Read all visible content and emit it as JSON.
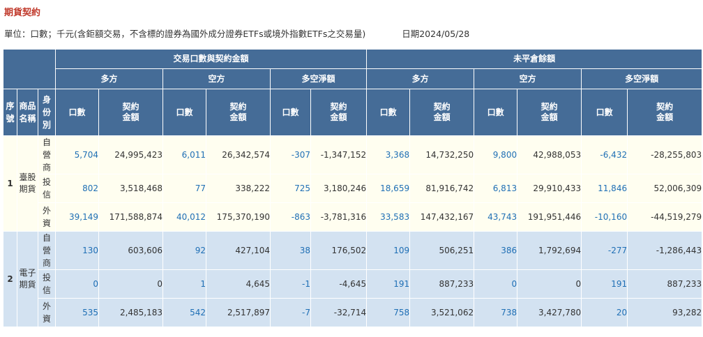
{
  "page": {
    "title": "期貨契約",
    "unit_note": "單位：口數；千元(含鉅額交易，不含標的證券為國外成分證券ETFs或境外指數ETFs之交易量)",
    "date_label": "日期2024/05/28"
  },
  "table": {
    "group_trading": "交易口數與契約金額",
    "group_oi": "未平倉餘額",
    "sub_long": "多方",
    "sub_short": "空方",
    "sub_net": "多空淨額",
    "col_seq": "序號",
    "col_product": "商品名稱",
    "col_investor": "身份別",
    "col_lots": "口數",
    "col_amount": "契約金額",
    "rows": [
      {
        "seq": "1",
        "product": "臺股期貨",
        "investor": "自營商",
        "tl_lots": "5,704",
        "tl_amt": "24,995,423",
        "ts_lots": "6,011",
        "ts_amt": "26,342,574",
        "tn_lots": "-307",
        "tn_amt": "-1,347,152",
        "ol_lots": "3,368",
        "ol_amt": "14,732,250",
        "os_lots": "9,800",
        "os_amt": "42,988,053",
        "on_lots": "-6,432",
        "on_amt": "-28,255,803"
      },
      {
        "investor": "投信",
        "tl_lots": "802",
        "tl_amt": "3,518,468",
        "ts_lots": "77",
        "ts_amt": "338,222",
        "tn_lots": "725",
        "tn_amt": "3,180,246",
        "ol_lots": "18,659",
        "ol_amt": "81,916,742",
        "os_lots": "6,813",
        "os_amt": "29,910,433",
        "on_lots": "11,846",
        "on_amt": "52,006,309"
      },
      {
        "investor": "外資",
        "tl_lots": "39,149",
        "tl_amt": "171,588,874",
        "ts_lots": "40,012",
        "ts_amt": "175,370,190",
        "tn_lots": "-863",
        "tn_amt": "-3,781,316",
        "ol_lots": "33,583",
        "ol_amt": "147,432,167",
        "os_lots": "43,743",
        "os_amt": "191,951,446",
        "on_lots": "-10,160",
        "on_amt": "-44,519,279"
      },
      {
        "seq": "2",
        "product": "電子期貨",
        "investor": "自營商",
        "tl_lots": "130",
        "tl_amt": "603,606",
        "ts_lots": "92",
        "ts_amt": "427,104",
        "tn_lots": "38",
        "tn_amt": "176,502",
        "ol_lots": "109",
        "ol_amt": "506,251",
        "os_lots": "386",
        "os_amt": "1,792,694",
        "on_lots": "-277",
        "on_amt": "-1,286,443"
      },
      {
        "investor": "投信",
        "tl_lots": "0",
        "tl_amt": "0",
        "ts_lots": "1",
        "ts_amt": "4,645",
        "tn_lots": "-1",
        "tn_amt": "-4,645",
        "ol_lots": "191",
        "ol_amt": "887,233",
        "os_lots": "0",
        "os_amt": "0",
        "on_lots": "191",
        "on_amt": "887,233"
      },
      {
        "investor": "外資",
        "tl_lots": "535",
        "tl_amt": "2,485,183",
        "ts_lots": "542",
        "ts_amt": "2,517,897",
        "tn_lots": "-7",
        "tn_amt": "-32,714",
        "ol_lots": "758",
        "ol_amt": "3,521,062",
        "os_lots": "738",
        "os_amt": "3,427,780",
        "on_lots": "20",
        "on_amt": "93,282"
      }
    ]
  }
}
